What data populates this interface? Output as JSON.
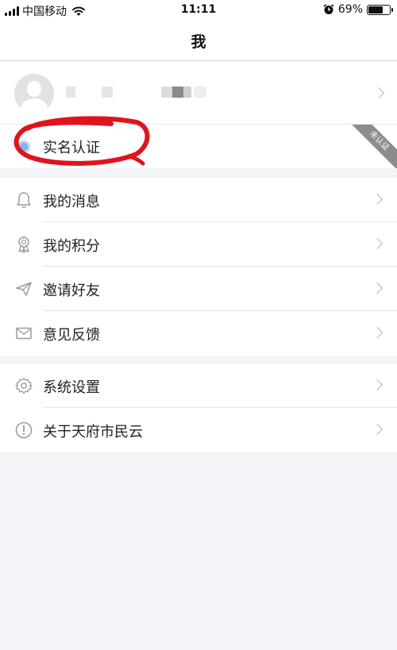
{
  "status_bar": {
    "carrier": "中国移动",
    "time": "11:11",
    "battery_percent": "69%",
    "battery_level": 0.69
  },
  "header": {
    "title": "我"
  },
  "verify": {
    "label": "实名认证",
    "badge": "未认证"
  },
  "menu": {
    "group1": [
      {
        "label": "我的消息",
        "icon": "bell-icon"
      },
      {
        "label": "我的积分",
        "icon": "medal-icon"
      },
      {
        "label": "邀请好友",
        "icon": "send-icon"
      },
      {
        "label": "意见反馈",
        "icon": "mail-icon"
      }
    ],
    "group2": [
      {
        "label": "系统设置",
        "icon": "gear-icon"
      },
      {
        "label": "关于天府市民云",
        "icon": "info-icon"
      }
    ]
  },
  "colors": {
    "background": "#f3f4f8",
    "annotation_red": "#e0141e",
    "verify_dot": "#7fb3f5"
  }
}
